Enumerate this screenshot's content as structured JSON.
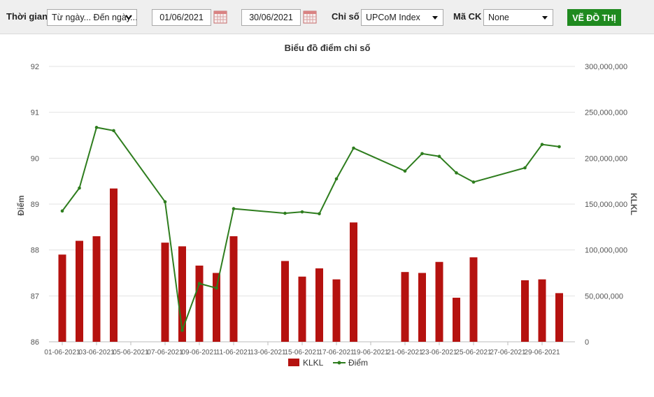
{
  "toolbar": {
    "time_label": "Thời gian",
    "time_select": "Từ ngày... Đến ngày...",
    "from_date": "01/06/2021",
    "to_date": "30/06/2021",
    "index_label": "Chỉ số",
    "index_select": "UPCoM Index",
    "code_label": "Mã CK",
    "code_select": "None",
    "draw_button": "VẼ ĐỒ THỊ"
  },
  "colors": {
    "bar": "#b5120f",
    "line": "#2e7d1e",
    "button": "#1f8a1f"
  },
  "chart_data": {
    "type": "bar+line",
    "title": "Biểu đồ điểm chỉ số",
    "ylabel": "Điểm",
    "y2label": "KLKL",
    "ylim": [
      86,
      92
    ],
    "y2lim": [
      0,
      300000000
    ],
    "y_ticks": [
      "86",
      "87",
      "88",
      "89",
      "90",
      "91",
      "92"
    ],
    "y2_ticks": [
      "0",
      "50,000,000",
      "100,000,000",
      "150,000,000",
      "200,000,000",
      "250,000,000",
      "300,000,000"
    ],
    "x_ticks": [
      "01-06-2021",
      "03-06-2021",
      "05-06-2021",
      "07-06-2021",
      "09-06-2021",
      "11-06-2021",
      "13-06-2021",
      "15-06-2021",
      "17-06-2021",
      "19-06-2021",
      "21-06-2021",
      "23-06-2021",
      "25-06-2021",
      "27-06-2021",
      "29-06-2021"
    ],
    "days": [
      1,
      2,
      3,
      4,
      7,
      8,
      9,
      10,
      11,
      14,
      15,
      16,
      17,
      18,
      21,
      22,
      23,
      24,
      25,
      28,
      29,
      30
    ],
    "grid": true,
    "legend_position": "bottom-center",
    "series": [
      {
        "name": "KLKL",
        "type": "bar",
        "axis": "right",
        "values": [
          95000000,
          110000000,
          115000000,
          167000000,
          108000000,
          104000000,
          83000000,
          75000000,
          115000000,
          88000000,
          71000000,
          80000000,
          68000000,
          130000000,
          76000000,
          75000000,
          87000000,
          48000000,
          92000000,
          67000000,
          68000000,
          53000000
        ]
      },
      {
        "name": "Điểm",
        "type": "line",
        "axis": "left",
        "values": [
          88.85,
          89.35,
          90.67,
          90.6,
          89.05,
          86.25,
          87.27,
          87.17,
          88.9,
          88.8,
          88.83,
          88.79,
          89.55,
          90.22,
          89.72,
          90.1,
          90.04,
          89.68,
          89.48,
          89.79,
          90.3,
          90.25
        ]
      }
    ]
  }
}
